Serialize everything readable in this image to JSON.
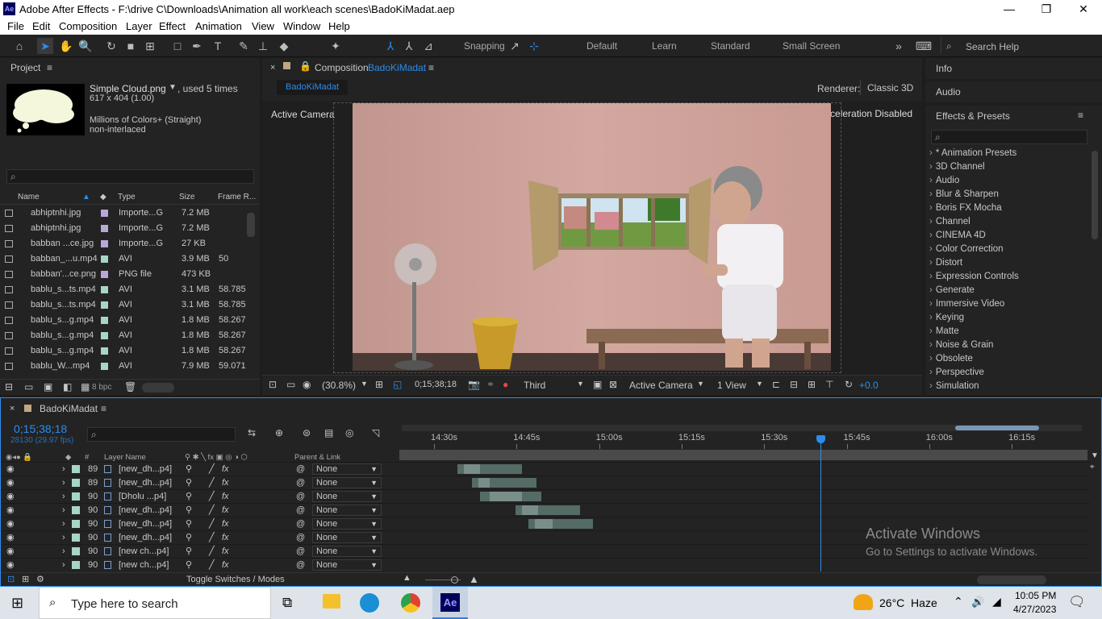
{
  "window": {
    "title": "Adobe After Effects - F:\\drive C\\Downloads\\Animation all work\\each scenes\\BadoKiMadat.aep",
    "logo": "Ae",
    "min": "—",
    "max": "❐",
    "close": "✕"
  },
  "menu": [
    "File",
    "Edit",
    "Composition",
    "Layer",
    "Effect",
    "Animation",
    "View",
    "Window",
    "Help"
  ],
  "toolbar": {
    "snapping": "Snapping",
    "workspaces": [
      "Default",
      "Learn",
      "Standard",
      "Small Screen"
    ],
    "more": "»",
    "search_placeholder": "Search Help"
  },
  "project": {
    "title": "Project",
    "item_name": "Simple Cloud.png",
    "used": ", used 5 times",
    "dims": "617 x 404 (1.00)",
    "colors": "Millions of Colors+ (Straight)",
    "interlace": "non-interlaced",
    "columns": [
      "Name",
      "Type",
      "Size",
      "Frame R..."
    ],
    "rows": [
      {
        "name": "abhiptnhi.jpg",
        "type": "Importe...G",
        "size": "7.2 MB",
        "fr": "",
        "color": "#b7a8d6"
      },
      {
        "name": "abhiptnhi.jpg",
        "type": "Importe...G",
        "size": "7.2 MB",
        "fr": "",
        "color": "#b7a8d6"
      },
      {
        "name": "babban ...ce.jpg",
        "type": "Importe...G",
        "size": "27 KB",
        "fr": "",
        "color": "#b7a8d6"
      },
      {
        "name": "babban_...u.mp4",
        "type": "AVI",
        "size": "3.9 MB",
        "fr": "50",
        "color": "#a8d6c4"
      },
      {
        "name": "babban'...ce.png",
        "type": "PNG file",
        "size": "473 KB",
        "fr": "",
        "color": "#b7a8d6"
      },
      {
        "name": "bablu_s...ts.mp4",
        "type": "AVI",
        "size": "3.1 MB",
        "fr": "58.785",
        "color": "#a8d6c4"
      },
      {
        "name": "bablu_s...ts.mp4",
        "type": "AVI",
        "size": "3.1 MB",
        "fr": "58.785",
        "color": "#a8d6c4"
      },
      {
        "name": "bablu_s...g.mp4",
        "type": "AVI",
        "size": "1.8 MB",
        "fr": "58.267",
        "color": "#a8d6c4"
      },
      {
        "name": "bablu_s...g.mp4",
        "type": "AVI",
        "size": "1.8 MB",
        "fr": "58.267",
        "color": "#a8d6c4"
      },
      {
        "name": "bablu_s...g.mp4",
        "type": "AVI",
        "size": "1.8 MB",
        "fr": "58.267",
        "color": "#a8d6c4"
      },
      {
        "name": "bablu_W...mp4",
        "type": "AVI",
        "size": "7.9 MB",
        "fr": "59.071",
        "color": "#a8d6c4"
      }
    ],
    "bpc": "8 bpc"
  },
  "composition": {
    "label": "Composition",
    "name": "BadoKiMadat",
    "tab": "BadoKiMadat",
    "renderer_label": "Renderer:",
    "renderer": "Classic 3D",
    "active_camera": "Active Camera",
    "display_accel": "Display Acceleration Disabled",
    "zoom": "(30.8%)",
    "timecode": "0;15;38;18",
    "quality": "Third",
    "view_camera": "Active Camera",
    "views": "1 View",
    "exposure": "+0.0"
  },
  "right": {
    "info": "Info",
    "audio": "Audio",
    "effects_title": "Effects & Presets",
    "effects": [
      "* Animation Presets",
      "3D Channel",
      "Audio",
      "Blur & Sharpen",
      "Boris FX Mocha",
      "Channel",
      "CINEMA 4D",
      "Color Correction",
      "Distort",
      "Expression Controls",
      "Generate",
      "Immersive Video",
      "Keying",
      "Matte",
      "Noise & Grain",
      "Obsolete",
      "Perspective",
      "Simulation"
    ]
  },
  "timeline": {
    "tab": "BadoKiMadat",
    "timecode": "0;15;38;18",
    "frames": "28130 (29.97 fps)",
    "col_layer": "Layer Name",
    "col_parent": "Parent & Link",
    "col_num": "#",
    "ruler": [
      "14:30s",
      "14:45s",
      "15:00s",
      "15:15s",
      "15:30s",
      "15:45s",
      "16:00s",
      "16:15s"
    ],
    "layers": [
      {
        "num": "89",
        "name": "[new_dh...p4]",
        "parent": "None"
      },
      {
        "num": "89",
        "name": "[new_dh...p4]",
        "parent": "None"
      },
      {
        "num": "90",
        "name": "[Dholu ...p4]",
        "parent": "None"
      },
      {
        "num": "90",
        "name": "[new_dh...p4]",
        "parent": "None"
      },
      {
        "num": "90",
        "name": "[new_dh...p4]",
        "parent": "None"
      },
      {
        "num": "90",
        "name": "[new_dh...p4]",
        "parent": "None"
      },
      {
        "num": "90",
        "name": "[new ch...p4]",
        "parent": "None"
      },
      {
        "num": "90",
        "name": "[new ch...p4]",
        "parent": "None"
      }
    ],
    "toggle": "Toggle Switches / Modes",
    "activate_title": "Activate Windows",
    "activate_sub": "Go to Settings to activate Windows."
  },
  "taskbar": {
    "search": "Type here to search",
    "weather": "26°C  Haze",
    "time": "10:05 PM",
    "date": "4/27/2023",
    "ae": "Ae"
  }
}
